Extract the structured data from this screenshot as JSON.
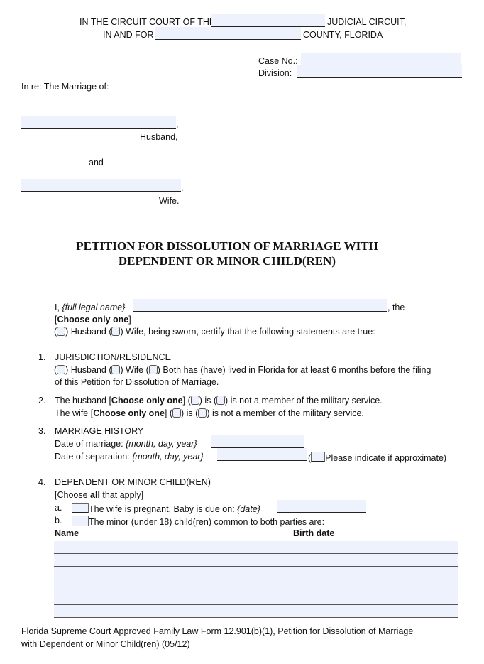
{
  "header": {
    "circuit_prefix": "IN THE CIRCUIT COURT OF THE",
    "circuit_suffix": "JUDICIAL CIRCUIT,",
    "county_prefix": "IN AND FOR",
    "county_suffix": "COUNTY, FLORIDA",
    "circuit_value": "",
    "county_value": ""
  },
  "case": {
    "case_no_label": "Case No.:",
    "division_label": "Division:",
    "case_no_value": "",
    "division_value": ""
  },
  "parties": {
    "in_re": "In re: The Marriage of:",
    "husband_label": "Husband,",
    "and_label": "and",
    "wife_label": "Wife.",
    "husband_value": "",
    "wife_value": "",
    "comma": ","
  },
  "title": {
    "line1": "PETITION FOR DISSOLUTION OF MARRIAGE WITH",
    "line2": "DEPENDENT OR MINOR CHILD(REN)"
  },
  "intro": {
    "prefix": "I, ",
    "name_hint": "{full legal name}",
    "suffix": ", the",
    "choose_open": "[",
    "choose_bold": "Choose only one",
    "choose_close": "]",
    "husband": ") Husband (",
    "wife_rest": ") Wife, being sworn, certify that the following statements are true:",
    "name_value": "",
    "husband_checked": false,
    "wife_checked": false
  },
  "section1": {
    "number": "1.",
    "heading": "JURISDICTION/RESIDENCE",
    "opt_husband": ") Husband (",
    "opt_wife": ") Wife (",
    "opt_both_rest": ") Both has (have) lived in Florida for at least 6 months before the filing",
    "line2": "of this Petition for Dissolution of Marriage.",
    "husband_checked": false,
    "wife_checked": false,
    "both_checked": false
  },
  "section2": {
    "number": "2.",
    "husband_prefix": "The husband [",
    "wife_prefix": "The wife [",
    "choose_bold": "Choose only one",
    "choose_close": "] (",
    "is": ") is (",
    "is_not": ") is not a member of the military service.",
    "husband_is": false,
    "husband_is_not": false,
    "wife_is": false,
    "wife_is_not": false
  },
  "section3": {
    "number": "3.",
    "heading": "MARRIAGE HISTORY",
    "marriage_label": "Date of marriage: ",
    "separation_label": "Date of separation: ",
    "date_hint": "{month, day, year}",
    "approx_open": "(",
    "approx_label": "Please indicate if approximate)",
    "marriage_value": "",
    "separation_value": "",
    "approx_checked": false
  },
  "section4": {
    "number": "4.",
    "heading": "DEPENDENT OR MINOR CHILD(REN)",
    "choose_open": "[Choose ",
    "choose_bold": "all",
    "choose_close": " that apply]",
    "item_a_letter": "a.",
    "item_a_text": "The wife is pregnant.  Baby is due on: ",
    "item_a_hint": "{date}",
    "item_b_letter": "b.",
    "item_b_text": "The minor (under 18) child(ren) common to both parties are:",
    "col_name": "Name",
    "col_birth": "Birth date",
    "due_date_value": "",
    "pregnant_checked": false,
    "minor_checked": false,
    "children": [
      {
        "name": "",
        "birth_date": ""
      },
      {
        "name": "",
        "birth_date": ""
      },
      {
        "name": "",
        "birth_date": ""
      },
      {
        "name": "",
        "birth_date": ""
      },
      {
        "name": "",
        "birth_date": ""
      },
      {
        "name": "",
        "birth_date": ""
      }
    ]
  },
  "footer": {
    "line1": "Florida Supreme Court Approved Family Law Form 12.901(b)(1), Petition for Dissolution of Marriage",
    "line2": "with Dependent  or Minor Child(ren) (05/12)"
  },
  "colors": {
    "field_fill": "#eef2fd",
    "text": "#111111"
  }
}
